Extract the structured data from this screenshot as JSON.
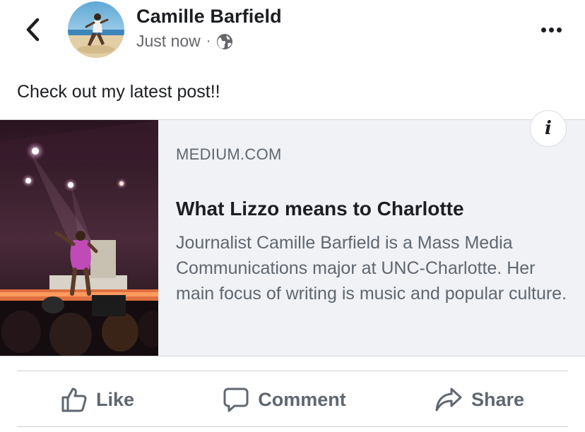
{
  "header": {
    "back_icon": "chevron-left-icon",
    "author_name": "Camille Barfield",
    "timestamp": "Just now",
    "separator": "·",
    "audience_icon": "globe-icon",
    "more_icon": "more-horizontal-icon"
  },
  "post": {
    "text": "Check out my latest post!!"
  },
  "link_preview": {
    "domain": "MEDIUM.COM",
    "title": "What Lizzo means to Charlotte",
    "description": "Journalist Camille Barfield is a Mass Media Communications major at UNC-Charlotte. Her main focus of writing is music and popular culture.",
    "info_label": "i"
  },
  "actions": {
    "like_label": "Like",
    "comment_label": "Comment",
    "share_label": "Share"
  },
  "colors": {
    "text_primary": "#1c1e21",
    "text_secondary": "#606770",
    "card_background": "#f0f2f5",
    "divider": "#ced0d4"
  }
}
